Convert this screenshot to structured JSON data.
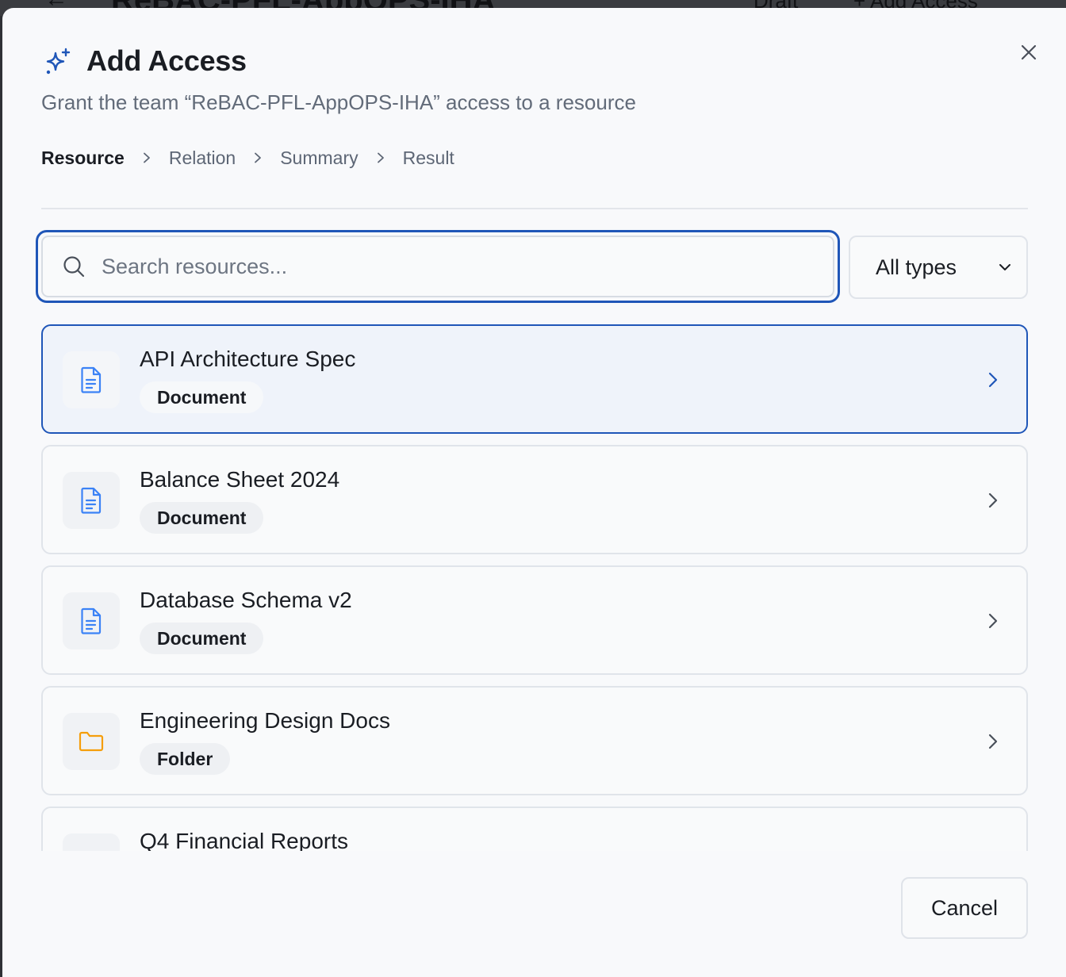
{
  "background": {
    "back_glyph": "←",
    "title": "ReBAC-PFL-AppOPS-IHA",
    "status": "Draft",
    "add_button": "+ Add Access"
  },
  "dialog": {
    "title": "Add Access",
    "subtitle": "Grant the team “ReBAC-PFL-AppOPS-IHA” access to a resource",
    "header_icon": "sparkles-icon",
    "close_icon": "close-icon",
    "accent_color": "#1f56b8"
  },
  "steps": [
    {
      "label": "Resource",
      "active": true
    },
    {
      "label": "Relation",
      "active": false
    },
    {
      "label": "Summary",
      "active": false
    },
    {
      "label": "Result",
      "active": false
    }
  ],
  "search": {
    "placeholder": "Search resources...",
    "value": ""
  },
  "type_filter": {
    "selected": "All types"
  },
  "resources": [
    {
      "name": "API Architecture Spec",
      "type": "Document",
      "icon": "document-icon",
      "selected": true
    },
    {
      "name": "Balance Sheet 2024",
      "type": "Document",
      "icon": "document-icon",
      "selected": false
    },
    {
      "name": "Database Schema v2",
      "type": "Document",
      "icon": "document-icon",
      "selected": false
    },
    {
      "name": "Engineering Design Docs",
      "type": "Folder",
      "icon": "folder-icon",
      "selected": false
    },
    {
      "name": "Q4 Financial Reports",
      "type": "",
      "icon": "",
      "selected": false
    }
  ],
  "footer": {
    "cancel_label": "Cancel"
  }
}
